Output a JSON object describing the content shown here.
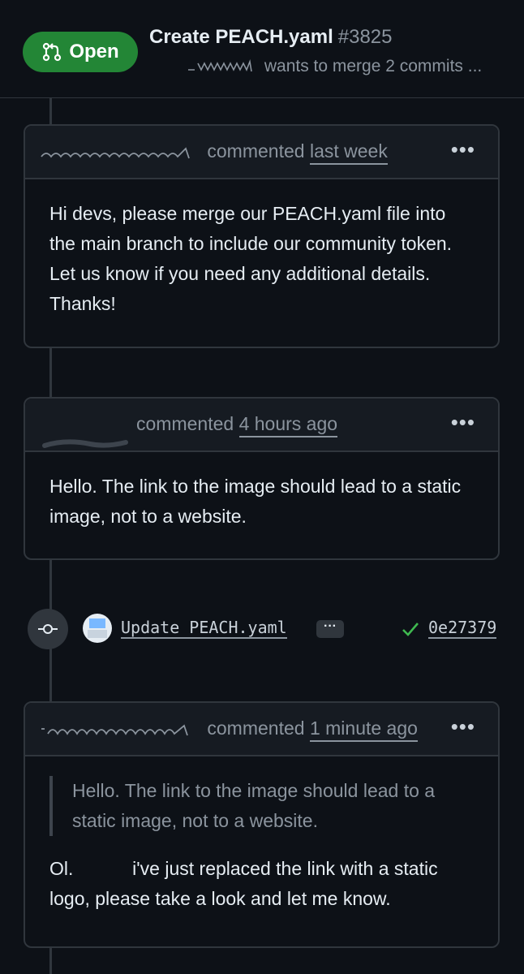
{
  "header": {
    "status_label": "Open",
    "title": "Create PEACH.yaml",
    "number": "#3825",
    "subtitle": "wants to merge 2 commits ..."
  },
  "comments": [
    {
      "action": "commented",
      "time": "last week",
      "menu": "•••",
      "body": "Hi devs, please merge our PEACH.yaml file into the main branch to include our community token. Let us know if you need any additional details. Thanks!"
    },
    {
      "action": "commented",
      "time": "4 hours ago",
      "menu": "•••",
      "body": "Hello. The link to the image should lead to a static image, not to a website."
    },
    {
      "action": "commented",
      "time": "1 minute ago",
      "menu": "•••",
      "quote": "Hello. The link to the image should lead to a static image, not to a website.",
      "body_prefix": "Ol.",
      "body_rest": "i've just replaced the link with a static logo, please take a look and let me know."
    }
  ],
  "commit": {
    "message": "Update PEACH.yaml",
    "expand_label": "···",
    "sha": "0e27379",
    "status_color": "#3fb950"
  },
  "colors": {
    "background": "#0d1117",
    "open_badge": "#238636",
    "border": "#30363d"
  },
  "icons": [
    "pull-request-icon",
    "commit-node-icon",
    "kebab-menu-icon",
    "check-icon"
  ]
}
